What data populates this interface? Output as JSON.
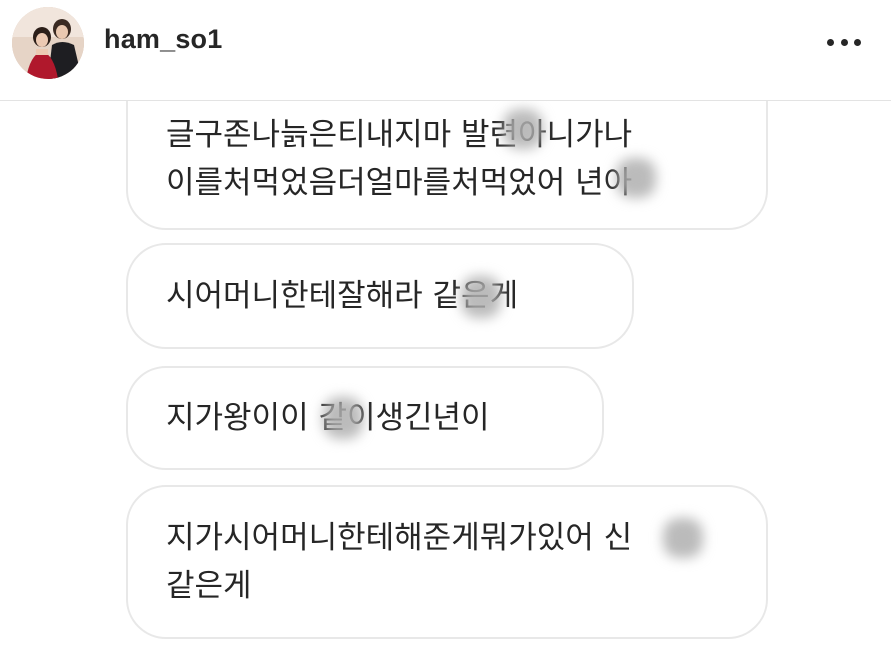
{
  "header": {
    "username": "ham_so1",
    "avatar_icon": "profile-photo-couple",
    "more_icon": "more-horizontal-icon"
  },
  "messages": [
    {
      "lines": [
        "글구존나늙은티내지마 발련아니가나",
        "이를처먹었음더얼마를처먹었어 년아"
      ]
    },
    {
      "lines": [
        "시어머니한테잘해라 같은게"
      ]
    },
    {
      "lines": [
        "지가왕이이 같이생긴년이"
      ]
    },
    {
      "lines": [
        "지가시어머니한테해준게뭐가있어 신",
        "같은게"
      ]
    }
  ],
  "colors": {
    "text": "#262626",
    "bubble_border": "#e8e8e8",
    "background": "#ffffff"
  }
}
